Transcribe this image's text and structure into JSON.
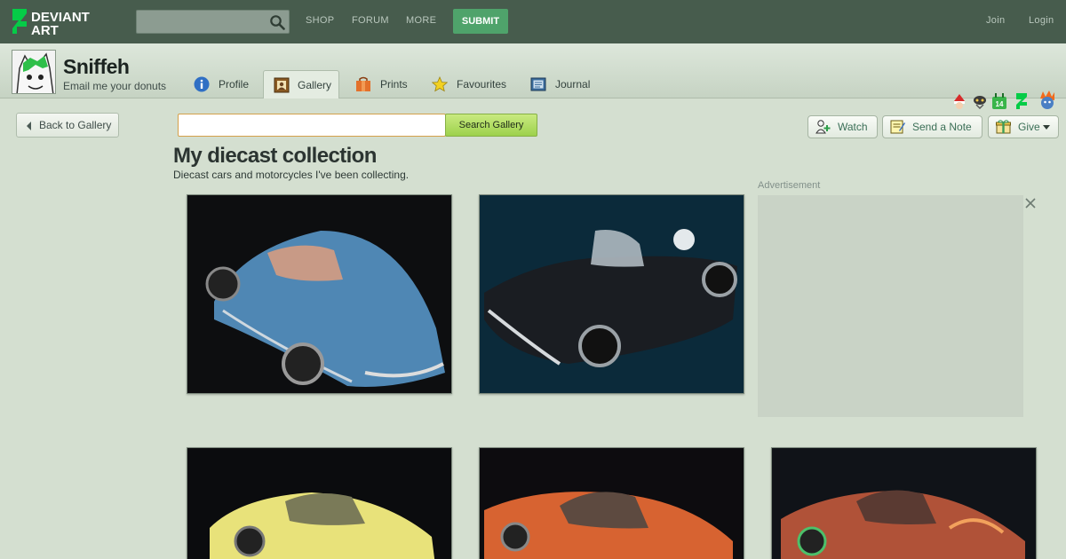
{
  "topnav": {
    "brand": "DEVIANT ART",
    "links": [
      "SHOP",
      "FORUM",
      "MORE"
    ],
    "submit": "SUBMIT",
    "join": "Join",
    "login": "Login"
  },
  "profile": {
    "username": "Sniffeh",
    "tagline": "Email me your donuts",
    "tabs": [
      {
        "label": "Profile",
        "icon": "info-icon"
      },
      {
        "label": "Gallery",
        "icon": "gallery-frame-icon",
        "active": true
      },
      {
        "label": "Prints",
        "icon": "prints-bag-icon"
      },
      {
        "label": "Favourites",
        "icon": "star-icon"
      },
      {
        "label": "Journal",
        "icon": "journal-icon"
      }
    ],
    "actions": {
      "watch": "Watch",
      "note": "Send a Note",
      "give": "Give"
    },
    "badge_number": "14"
  },
  "gallery": {
    "back_label": "Back to Gallery",
    "search_button": "Search Gallery",
    "title": "My diecast collection",
    "description": "Diecast cars and motorcycles I've been collecting.",
    "ad_label": "Advertisement",
    "thumbnails": [
      {
        "subject": "blue corvette",
        "color": "#4f87b4"
      },
      {
        "subject": "black roadster",
        "color": "#1a1d22"
      },
      {
        "subject": "yellow muscle car",
        "color": "#e8e27a"
      },
      {
        "subject": "orange muscle car",
        "color": "#d76331"
      },
      {
        "subject": "red flame muscle car",
        "color": "#b05238"
      }
    ]
  },
  "colors": {
    "topbar": "#475c4d",
    "submit": "#4fa36b",
    "page_bg": "#d4dfd0",
    "search_btn": "#9dd14c"
  }
}
